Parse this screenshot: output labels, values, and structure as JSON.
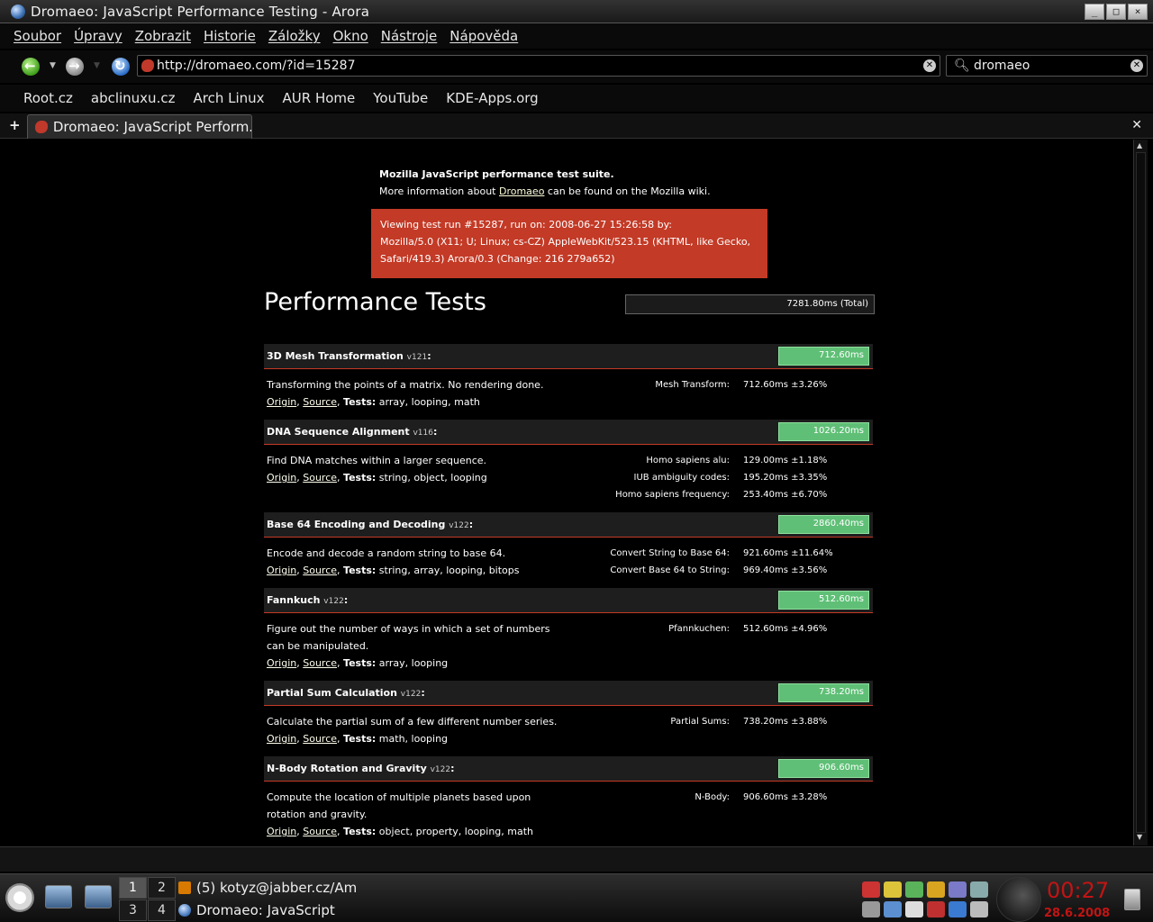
{
  "window": {
    "title": "Dromaeo: JavaScript Performance Testing - Arora"
  },
  "menu": [
    "Soubor",
    "Úpravy",
    "Zobrazit",
    "Historie",
    "Záložky",
    "Okno",
    "Nástroje",
    "Nápověda"
  ],
  "nav": {
    "url": "http://dromaeo.com/?id=15287",
    "search_value": "dromaeo"
  },
  "bookmarks": [
    "Root.cz",
    "abclinuxu.cz",
    "Arch Linux",
    "AUR Home",
    "YouTube",
    "KDE-Apps.org"
  ],
  "tab": {
    "label": "Dromaeo: JavaScript Perform."
  },
  "page": {
    "intro_heading": "Mozilla JavaScript performance test suite.",
    "intro_pre": "More information about ",
    "intro_link": "Dromaeo",
    "intro_post": " can be found on the Mozilla wiki.",
    "run_line1": "Viewing test run #15287, run on: 2008-06-27 15:26:58 by:",
    "run_line2": "Mozilla/5.0 (X11; U; Linux; cs-CZ) AppleWebKit/523.15 (KHTML, like Gecko,",
    "run_line3": "Safari/419.3) Arora/0.3 (Change: 216 279a652)",
    "title": "Performance Tests",
    "total": "7281.80ms (Total)",
    "origin_label": "Origin",
    "source_label": "Source",
    "tests_label": "Tests:",
    "tests": [
      {
        "name": "3D Mesh Transformation",
        "version": "v121",
        "time": "712.60ms",
        "desc": "Transforming the points of a matrix. No rendering done.",
        "tags": "array, looping, math",
        "subs": [
          {
            "label": "Mesh Transform:",
            "value": "712.60ms ±3.26%"
          }
        ]
      },
      {
        "name": "DNA Sequence Alignment",
        "version": "v116",
        "time": "1026.20ms",
        "desc": "Find DNA matches within a larger sequence.",
        "tags": "string, object, looping",
        "subs": [
          {
            "label": "Homo sapiens alu:",
            "value": "129.00ms ±1.18%"
          },
          {
            "label": "IUB ambiguity codes:",
            "value": "195.20ms ±3.35%"
          },
          {
            "label": "Homo sapiens frequency:",
            "value": "253.40ms ±6.70%"
          }
        ]
      },
      {
        "name": "Base 64 Encoding and Decoding",
        "version": "v122",
        "time": "2860.40ms",
        "desc": "Encode and decode a random string to base 64.",
        "tags": "string, array, looping, bitops",
        "subs": [
          {
            "label": "Convert String to Base 64:",
            "value": "921.60ms ±11.64%"
          },
          {
            "label": "Convert Base 64 to String:",
            "value": "969.40ms ±3.56%"
          }
        ]
      },
      {
        "name": "Fannkuch",
        "version": "v122",
        "time": "512.60ms",
        "desc": "Figure out the number of ways in which a set of numbers can be manipulated.",
        "tags": "array, looping",
        "subs": [
          {
            "label": "Pfannkuchen:",
            "value": "512.60ms ±4.96%"
          }
        ]
      },
      {
        "name": "Partial Sum Calculation",
        "version": "v122",
        "time": "738.20ms",
        "desc": "Calculate the partial sum of a few different number series.",
        "tags": "math, looping",
        "subs": [
          {
            "label": "Partial Sums:",
            "value": "738.20ms ±3.88%"
          }
        ]
      },
      {
        "name": "N-Body Rotation and Gravity",
        "version": "v122",
        "time": "906.60ms",
        "desc": "Compute the location of multiple planets based upon rotation and gravity.",
        "tags": "object, property, looping, math",
        "subs": [
          {
            "label": "N-Body:",
            "value": "906.60ms ±3.28%"
          }
        ]
      }
    ]
  },
  "taskbar": {
    "desktops": [
      "1",
      "2",
      "3",
      "4"
    ],
    "tasks": [
      "(5) kotyz@jabber.cz/Am",
      "Dromaeo: JavaScript"
    ],
    "clock": "00:27",
    "date": "28.6.2008"
  },
  "colors": {
    "accent_red": "#c33a26",
    "bar_green": "#5fbf76",
    "clock_red": "#c21414"
  }
}
